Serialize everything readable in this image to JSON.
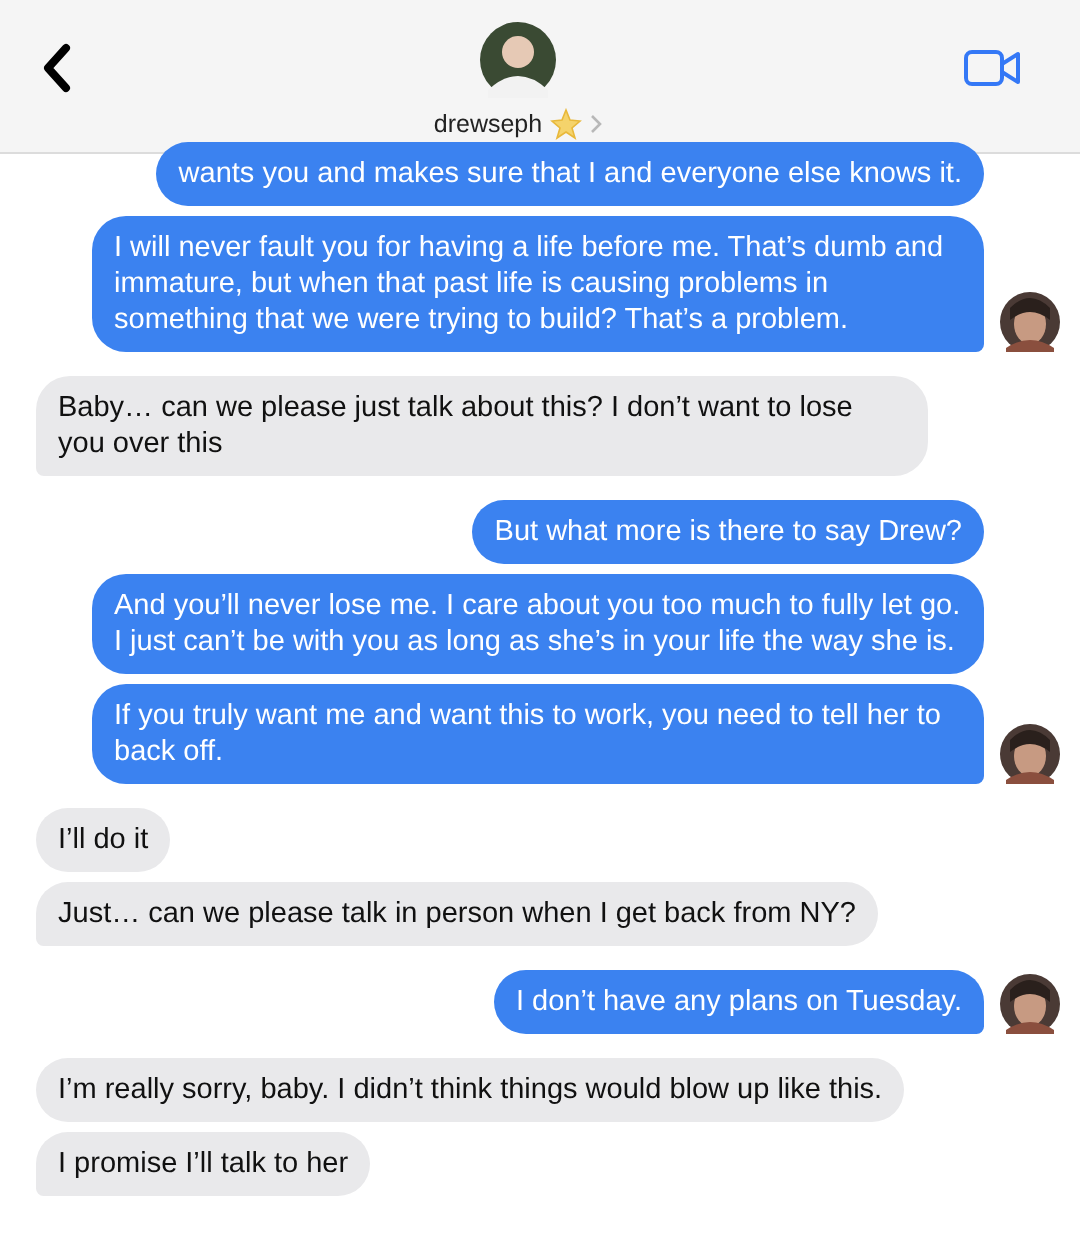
{
  "header": {
    "contact_name": "drewseph"
  },
  "messages": [
    {
      "kind": "sent",
      "text": "wants you and makes sure that I and everyone else knows it.",
      "tail": false
    },
    {
      "kind": "sent",
      "text": "I will never fault you for having a life before me. That’s dumb and immature, but when that past life is causing problems in something that we were trying to build? That’s a problem.",
      "tail": true
    },
    {
      "kind": "received",
      "text": "Baby… can we please just talk about this? I don’t want to lose you over this",
      "tail": true
    },
    {
      "kind": "sent",
      "text": "But what more is there to say Drew?",
      "tail": false
    },
    {
      "kind": "sent",
      "text": "And you’ll never lose me. I care about you too much to fully let go. I just can’t be with you as long as she’s in your life the way she is.",
      "tail": false
    },
    {
      "kind": "sent",
      "text": "If you truly want me and want this to work, you need to tell her to back off.",
      "tail": true
    },
    {
      "kind": "received",
      "text": "I’ll do it",
      "tail": false
    },
    {
      "kind": "received",
      "text": "Just… can we please talk in person when I get back from NY?",
      "tail": true
    },
    {
      "kind": "sent",
      "text": "I don’t have any plans on Tuesday.",
      "tail": true
    },
    {
      "kind": "received",
      "text": "I’m really sorry, baby. I didn’t think things would blow up like this.",
      "tail": false
    },
    {
      "kind": "received",
      "text": "I promise I’ll talk to her",
      "tail": true
    }
  ]
}
